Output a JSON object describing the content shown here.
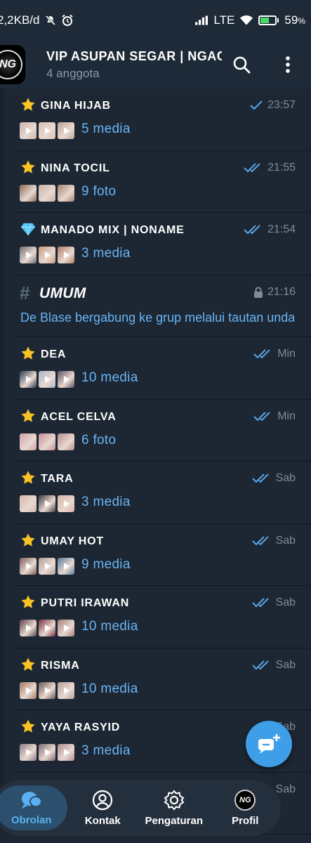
{
  "status": {
    "speed": "2,2KB/d",
    "network": "LTE",
    "battery_pct": "59",
    "battery_unit": "%",
    "battery_level": 0.59
  },
  "header": {
    "logo_text": "NG",
    "title": "VIP ASUPAN SEGAR | NGACENG SEGER",
    "subtitle": "4 anggota"
  },
  "chats": [
    {
      "icon": "star-icon",
      "name": "GINA HIJAB",
      "time": "23:57",
      "check": "single",
      "summary": "5 media",
      "thumbs": [
        "#cbb3a8",
        "#d9c2b5",
        "#bfa595"
      ],
      "play": [
        true,
        true,
        true
      ]
    },
    {
      "icon": "star-icon",
      "name": "NINA TOCIL",
      "time": "21:55",
      "check": "double",
      "summary": "9 foto",
      "thumbs": [
        "#8a6a55",
        "#c8b0a3",
        "#a88070"
      ],
      "play": [
        false,
        false,
        false
      ]
    },
    {
      "icon": "diamond-icon",
      "name": "MANADO MIX | NONAME",
      "time": "21:54",
      "check": "double",
      "summary": "3 media",
      "thumbs": [
        "#6d6e73",
        "#c79a7d",
        "#b27d69"
      ],
      "play": [
        true,
        true,
        true
      ]
    },
    {
      "icon": "hash-icon",
      "name": "UMUM",
      "time": "21:16",
      "check": "lock",
      "message": "De Blase bergabung ke grup melalui tautan undangan"
    },
    {
      "icon": "star-icon",
      "name": "DEA",
      "time": "Min",
      "check": "double",
      "summary": "10 media",
      "thumbs": [
        "#2c3a54",
        "#a9b6c9",
        "#5b5060"
      ],
      "play": [
        true,
        true,
        true
      ]
    },
    {
      "icon": "star-icon",
      "name": "ACEL CELVA",
      "time": "Min",
      "check": "double",
      "summary": "6 foto",
      "thumbs": [
        "#d3a0a8",
        "#c58b95",
        "#b68d8a"
      ],
      "play": [
        false,
        false,
        false
      ]
    },
    {
      "icon": "star-icon",
      "name": "TARA",
      "time": "Sab",
      "check": "double",
      "summary": "3 media",
      "thumbs": [
        "#d6b8aa",
        "#463d40",
        "#d8b2a6"
      ],
      "play": [
        false,
        true,
        true
      ]
    },
    {
      "icon": "star-icon",
      "name": "UMAY HOT",
      "time": "Sab",
      "check": "double",
      "summary": "9 media",
      "thumbs": [
        "#7d5f58",
        "#b4a29a",
        "#5b7a9a"
      ],
      "play": [
        true,
        true,
        true
      ]
    },
    {
      "icon": "star-icon",
      "name": "PUTRI IRAWAN",
      "time": "Sab",
      "check": "double",
      "summary": "10 media",
      "thumbs": [
        "#5c4046",
        "#7a2f3f",
        "#a6807a"
      ],
      "play": [
        true,
        true,
        true
      ]
    },
    {
      "icon": "star-icon",
      "name": "RISMA",
      "time": "Sab",
      "check": "double",
      "summary": "10 media",
      "thumbs": [
        "#a47a60",
        "#6b5a54",
        "#b8a29a"
      ],
      "play": [
        true,
        true,
        true
      ]
    },
    {
      "icon": "star-icon",
      "name": "YAYA RASYID",
      "time": "Sab",
      "check": "double",
      "summary": "3 media",
      "thumbs": [
        "#8e7e8a",
        "#7c6a72",
        "#b08c90"
      ],
      "play": [
        true,
        true,
        true
      ]
    },
    {
      "icon": "star-icon",
      "name": "",
      "time": "Sab",
      "check": "double",
      "summary": "",
      "thumbs": [],
      "play": []
    }
  ],
  "nav": {
    "items": [
      {
        "label": "Obrolan",
        "icon": "chat-bubbles-icon"
      },
      {
        "label": "Kontak",
        "icon": "person-icon"
      },
      {
        "label": "Pengaturan",
        "icon": "gear-icon"
      },
      {
        "label": "Profil",
        "icon": "avatar-icon"
      }
    ]
  },
  "colors": {
    "accent": "#6ab3f3",
    "background": "#1c2733",
    "fab": "#3e9ee8"
  }
}
